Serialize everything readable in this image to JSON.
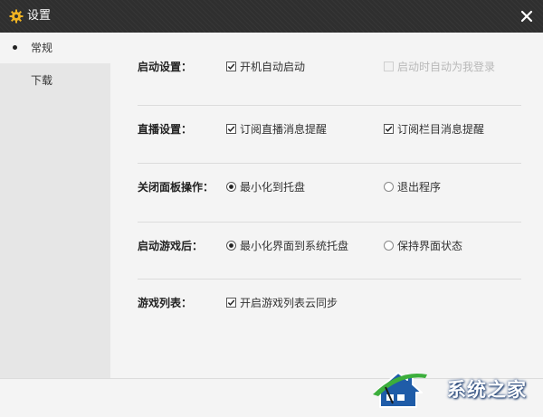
{
  "window": {
    "title": "设置"
  },
  "icons": {
    "title": "gear-icon",
    "close": "close-icon"
  },
  "colors": {
    "titlebar": "#2f2f2f",
    "sidebar": "#e6e6e6",
    "content": "#f4f4f4",
    "watermark_bg": "#1f5ca8"
  },
  "sidebar": {
    "items": [
      {
        "label": "常规",
        "active": true
      },
      {
        "label": "下载",
        "active": false
      }
    ]
  },
  "settings": {
    "startup": {
      "label": "启动设置：",
      "options": [
        {
          "label": "开机自动启动",
          "checked": true,
          "disabled": false
        },
        {
          "label": "启动时自动为我登录",
          "checked": false,
          "disabled": true
        }
      ]
    },
    "live": {
      "label": "直播设置：",
      "options": [
        {
          "label": "订阅直播消息提醒",
          "checked": true
        },
        {
          "label": "订阅栏目消息提醒",
          "checked": true
        }
      ]
    },
    "close_panel": {
      "label": "关闭面板操作：",
      "options": [
        {
          "label": "最小化到托盘",
          "selected": true
        },
        {
          "label": "退出程序",
          "selected": false
        }
      ]
    },
    "after_game": {
      "label": "启动游戏后：",
      "options": [
        {
          "label": "最小化界面到系统托盘",
          "selected": true
        },
        {
          "label": "保持界面状态",
          "selected": false
        }
      ]
    },
    "game_list": {
      "label": "游戏列表：",
      "options": [
        {
          "label": "开启游戏列表云同步",
          "checked": true
        }
      ]
    }
  },
  "watermark": {
    "text": "系统之家"
  }
}
